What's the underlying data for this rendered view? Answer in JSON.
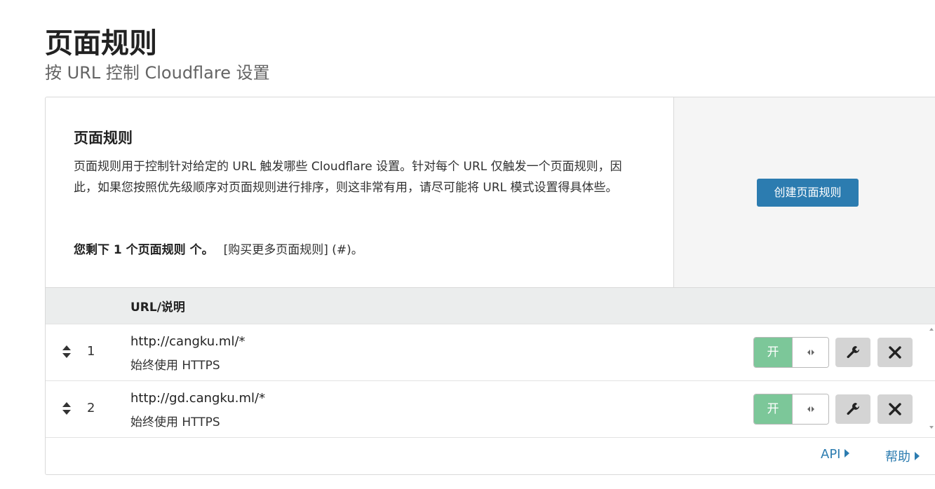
{
  "header": {
    "title": "页面规则",
    "subtitle": "按 URL 控制 Cloudflare 设置"
  },
  "intro": {
    "title": "页面规则",
    "description": "页面规则用于控制针对给定的 URL 触发哪些 Cloudflare 设置。针对每个 URL 仅触发一个页面规则，因此，如果您按照优先级顺序对页面规则进行排序，则这非常有用，请尽可能将 URL 模式设置得具体些。",
    "remaining_bold": "您剩下 1 个页面规则 个。",
    "buy_more": "[购买更多页面规则] (#)。"
  },
  "create_button": "创建页面规则",
  "table": {
    "column_url": "URL/说明",
    "rows": [
      {
        "priority": "1",
        "url": "http://cangku.ml/*",
        "description": "始终使用 HTTPS",
        "toggle_label": "开"
      },
      {
        "priority": "2",
        "url": "http://gd.cangku.ml/*",
        "description": "始终使用 HTTPS",
        "toggle_label": "开"
      }
    ]
  },
  "footer": {
    "api": "API",
    "help": "帮助"
  },
  "icons": {
    "drag": "sort-arrows-icon",
    "edit": "wrench-icon",
    "delete": "close-icon",
    "toggle_handle": "left-right-arrows-icon"
  },
  "colors": {
    "primary": "#2c7cb0",
    "toggle_on": "#7cc799",
    "icon_button_bg": "#d4d4d4",
    "table_header_bg": "#ebeded",
    "side_panel_bg": "#f5f5f5"
  }
}
